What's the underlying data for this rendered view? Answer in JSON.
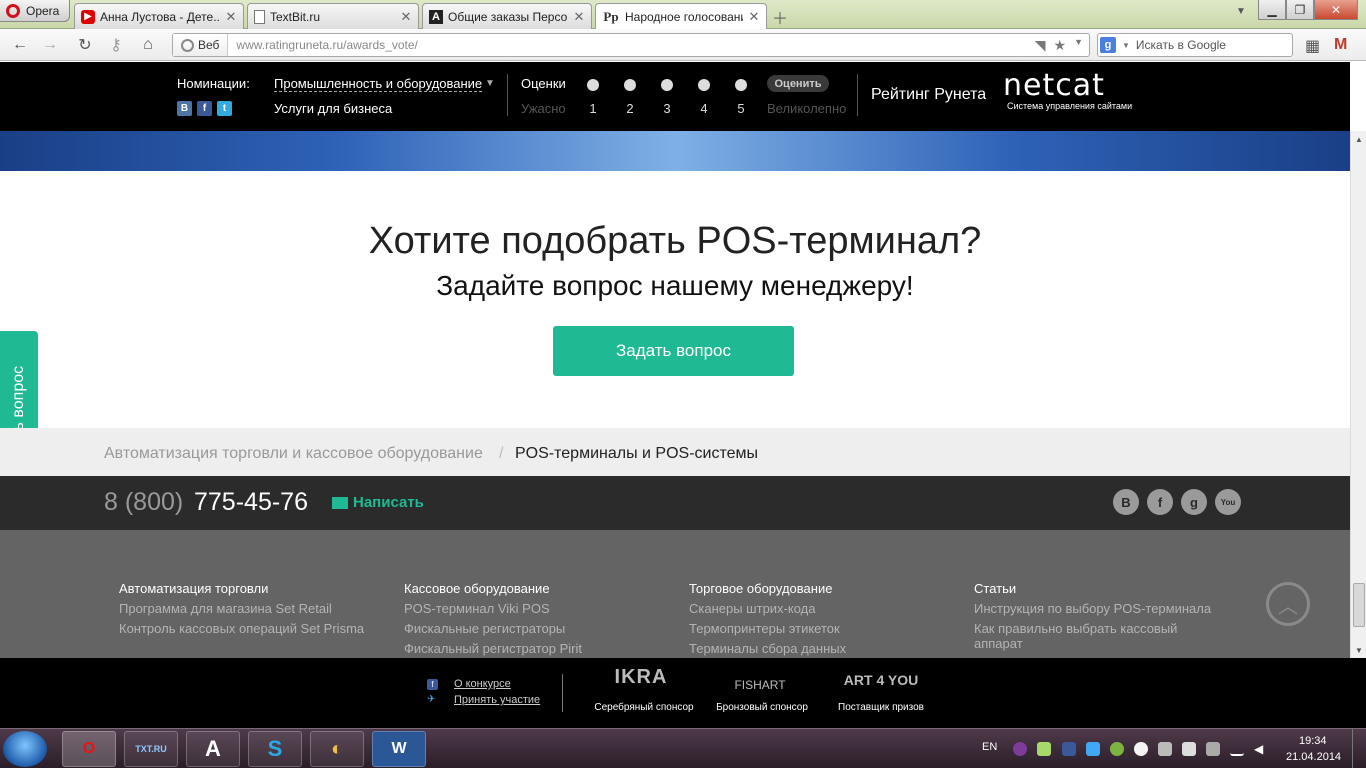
{
  "browser": {
    "opera_label": "Opera",
    "tabs": [
      {
        "title": "Анна Лустова - Дете..."
      },
      {
        "title": "TextBit.ru"
      },
      {
        "title": "Общие заказы Персо..."
      },
      {
        "title": "Народное голосовани..."
      }
    ],
    "address": {
      "badge": "Веб",
      "url": "www.ratingruneta.ru/awards_vote/"
    },
    "search_placeholder": "Искать в Google"
  },
  "site_header": {
    "nominations_label": "Номинации:",
    "nomination_value": "Промышленность и оборудование",
    "nomination_sub": "Услуги для бизнеса",
    "social": [
      "B",
      "f",
      "t"
    ],
    "ratings_label": "Оценки",
    "rating_bad": "Ужасно",
    "rating_good": "Великолепно",
    "rating_numbers": [
      "1",
      "2",
      "3",
      "4",
      "5"
    ],
    "rate_button": "Оценить",
    "runet_title": "Рейтинг Рунета",
    "netcat_logo": "netcat",
    "netcat_sub": "Система управления сайтами"
  },
  "promo": {
    "title": "Хотите подобрать POS-терминал?",
    "subtitle": "Задайте вопрос нашему менеджеру!",
    "button": "Задать вопрос"
  },
  "side_tab": "Задать вопрос",
  "breadcrumbs": {
    "parent": "Автоматизация торговли и кассовое оборудование",
    "separator": "/",
    "current": "POS-терминалы и POS-системы"
  },
  "contact": {
    "phone_code": "8 (800)",
    "phone_number": "775-45-76",
    "write_label": "Написать",
    "social": [
      "B",
      "f",
      "g",
      "You"
    ]
  },
  "footer_columns": [
    {
      "heading": "Автоматизация торговли",
      "links": [
        "Программа для магазина Set Retail",
        "Контроль кассовых операций Set Prisma"
      ]
    },
    {
      "heading": "Кассовое оборудование",
      "links": [
        "POS-терминал Viki POS",
        "Фискальные регистраторы",
        "Фискальный регистратор Pirit"
      ]
    },
    {
      "heading": "Торговое оборудование",
      "links": [
        "Сканеры штрих-кода",
        "Термопринтеры этикеток",
        "Терминалы сбора данных"
      ]
    },
    {
      "heading": "Статьи",
      "links": [
        "Инструкция по выбору POS-терминала",
        "Как правильно выбрать кассовый аппарат"
      ]
    }
  ],
  "bottom_bar": {
    "about_link": "О конкурсе",
    "participate_link": "Принять участие",
    "sponsors": [
      {
        "logo": "IKRA",
        "caption": "Серебряный спонсор"
      },
      {
        "logo": "FISHART",
        "caption": "Бронзовый спонсор"
      },
      {
        "logo": "ART 4 YOU",
        "caption": "Поставщик призов"
      }
    ]
  },
  "taskbar": {
    "apps": [
      "O",
      "TXT.RU",
      "A",
      "S",
      "",
      "W"
    ],
    "lang": "EN",
    "time": "19:34",
    "date": "21.04.2014"
  }
}
